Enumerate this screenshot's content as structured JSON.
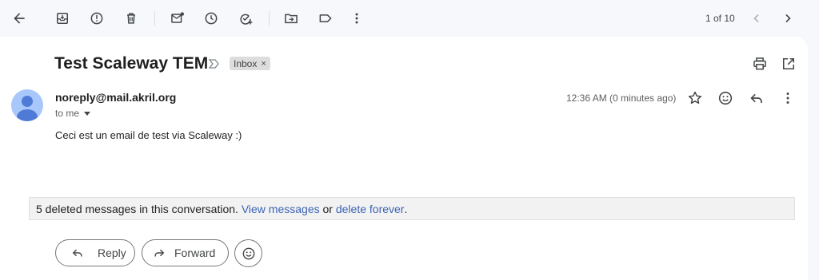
{
  "toolbar": {
    "icons": [
      "back-arrow-icon",
      "archive-icon",
      "report-spam-icon",
      "delete-icon",
      "mark-unread-icon",
      "snooze-icon",
      "add-to-tasks-icon",
      "move-to-icon",
      "label-icon",
      "more-vert-icon"
    ],
    "pager_text": "1 of 10"
  },
  "thread": {
    "subject": "Test Scaleway TEM",
    "label_chip": "Inbox",
    "label_close": "×"
  },
  "message": {
    "sender": "noreply@mail.akril.org",
    "to_text": "to me",
    "time": "12:36 AM (0 minutes ago)",
    "body": "Ceci est un email de test via Scaleway :)"
  },
  "deleted_notice": {
    "prefix": "5 deleted messages in this conversation.",
    "view_link": "View messages",
    "middle": "or",
    "delete_link": "delete forever",
    "suffix": "."
  },
  "actions": {
    "reply_label": "Reply",
    "forward_label": "Forward"
  },
  "colors": {
    "background": "#f6f8fc",
    "card": "#ffffff",
    "link": "#3c64b4",
    "avatar": "#a8c7fa",
    "avatar_figure": "#4f7bd6"
  }
}
